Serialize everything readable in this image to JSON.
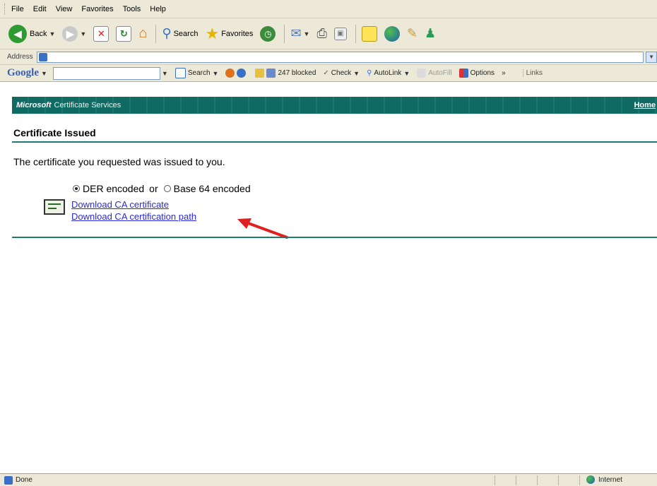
{
  "menu": [
    "File",
    "Edit",
    "View",
    "Favorites",
    "Tools",
    "Help"
  ],
  "toolbar": {
    "back_label": "Back",
    "search_label": "Search",
    "favorites_label": "Favorites"
  },
  "address": {
    "label": "Address",
    "value": ""
  },
  "google_toolbar": {
    "logo": "Google",
    "search_label": "Search",
    "blocked_label": "247 blocked",
    "check_label": "Check",
    "autolink_label": "AutoLink",
    "autofill_label": "AutoFill",
    "options_label": "Options",
    "more": "»",
    "links_label": "Links"
  },
  "page": {
    "banner_brand": "Microsoft",
    "banner_service": "Certificate Services",
    "banner_home": "Home",
    "title": "Certificate Issued",
    "message": "The certificate you requested was issued to you.",
    "der_label": "DER encoded",
    "or_label": "or",
    "base64_label": "Base 64 encoded",
    "selected_encoding": "DER encoded",
    "download_cert": "Download CA certificate",
    "download_path": "Download CA certification path"
  },
  "status": {
    "text": "Done",
    "zone": "Internet"
  },
  "colors": {
    "banner": "#0e6a62",
    "link": "#2a2ad8",
    "arrow": "#e02020",
    "rule": "#1c7a72"
  }
}
